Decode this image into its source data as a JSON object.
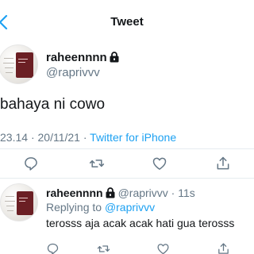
{
  "header": {
    "title": "Tweet"
  },
  "tweet": {
    "author_name": "raheennnn",
    "author_handle": "@raprivvv",
    "text": "bahaya ni cowo",
    "time": "23.14",
    "date": "20/11/21",
    "separator": "·",
    "source": "Twitter for iPhone"
  },
  "reply": {
    "author_name": "raheennnn",
    "handle_time": "@raprivvv · 11s",
    "replying_prefix": "Replying to",
    "replying_to": "@raprivvv",
    "text": "terosss aja acak acak hati gua terosss"
  },
  "colors": {
    "accent": "#1da1f2",
    "muted": "#657786",
    "text": "#14171a",
    "divider": "#e6ecf0"
  },
  "icons": [
    "back-chevron-icon",
    "lock-icon",
    "reply-icon",
    "retweet-icon",
    "like-icon",
    "share-icon"
  ]
}
